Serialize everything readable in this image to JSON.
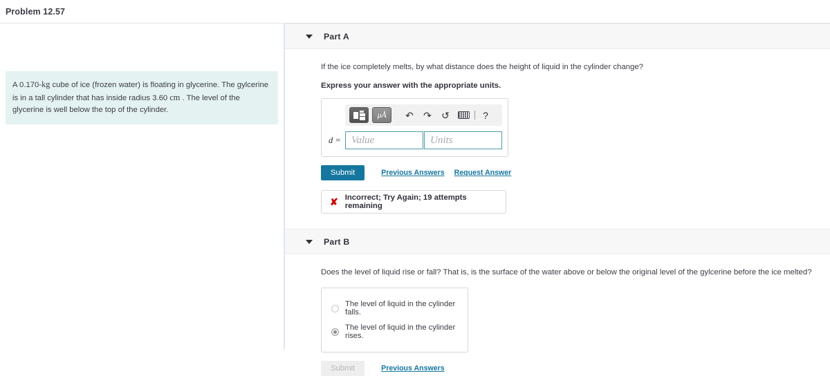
{
  "header": {
    "problem_title": "Problem 12.57"
  },
  "statement": {
    "text_1": "A 0.170-",
    "unit_kg": "kg",
    "text_2": " cube of ice (frozen water) is floating in glycerine. The gylcerine is in a tall cylinder that has inside radius 3.60 ",
    "unit_cm": "cm",
    "text_3": " . The level of the glycerine is well below the top of the cylinder."
  },
  "parts": [
    {
      "label": "Part A",
      "question": "If the ice completely melts, by what distance does the height of liquid in the cylinder change?",
      "instruction": "Express your answer with the appropriate units.",
      "toolbar": {
        "template_button": "template-icon",
        "units_button": "μÅ",
        "undo": "↶",
        "redo": "↷",
        "reset": "↺",
        "keyboard": "keyboard-icon",
        "help": "?"
      },
      "variable_label": "d =",
      "value_placeholder": "Value",
      "units_placeholder": "Units",
      "value_current": "",
      "units_current": "",
      "submit_label": "Submit",
      "previous_answers_label": "Previous Answers",
      "request_answer_label": "Request Answer",
      "feedback": {
        "icon": "cross-icon",
        "text": "Incorrect; Try Again; 19 attempts remaining",
        "color": "#cc0000"
      }
    },
    {
      "label": "Part B",
      "question": "Does the level of liquid rise or fall? That is, is the surface of the water above or below the original level of the gylcerine before the ice melted?",
      "options": [
        {
          "label": "The level of liquid in the cylinder falls.",
          "selected": false
        },
        {
          "label": "The level of liquid in the cylinder rises.",
          "selected": true
        }
      ],
      "submit_label": "Submit",
      "submit_disabled": true,
      "previous_answers_label": "Previous Answers"
    }
  ],
  "colors": {
    "accent": "#1577a0",
    "statement_bg": "#e4f2f1",
    "field_border": "#4e9aa4",
    "error": "#cc0000",
    "band_bg": "#f7f7f8"
  }
}
